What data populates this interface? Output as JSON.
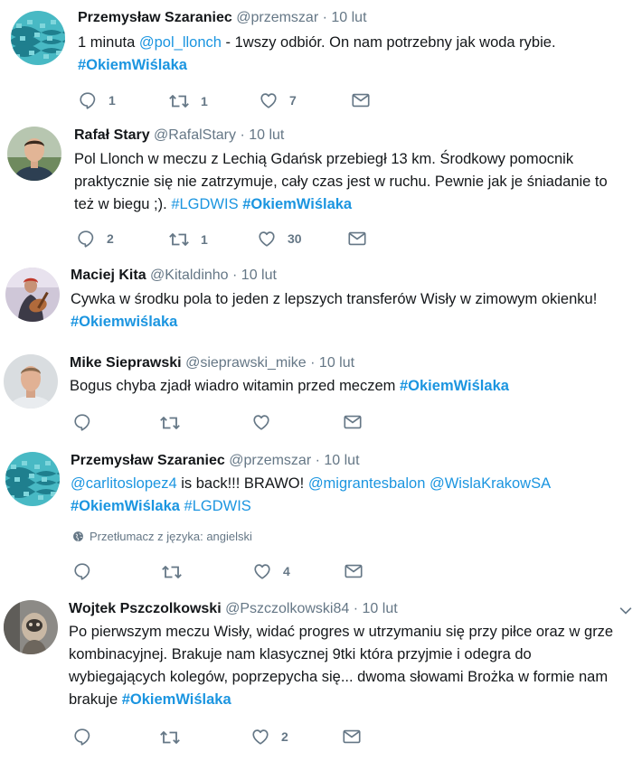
{
  "tweets": [
    {
      "name": "Przemysław Szaraniec",
      "handle": "@przemszar",
      "dot": "·",
      "date": "10 lut",
      "text_a": "1 minuta ",
      "mention": "@pol_llonch",
      "text_b": " - 1wszy odbiór. On nam potrzebny jak woda rybie.",
      "hashtag": "#OkiemWiślaka",
      "replies": "1",
      "retweets": "1",
      "likes": "7"
    },
    {
      "name": "Rafał Stary",
      "handle": "@RafalStary",
      "dot": "·",
      "date": "10 lut",
      "line1": "Pol Llonch w meczu z Lechią Gdańsk przebiegł 13 km. Środkowy pomocnik",
      "line2": "praktycznie się nie zatrzymuje, cały czas jest w ruchu. Pewnie jak je śniadanie to",
      "line3": "też w biegu ;). ",
      "hashtag1": "#LGDWIS",
      "hashtag2": "#OkiemWiślaka",
      "replies": "2",
      "retweets": "1",
      "likes": "30"
    },
    {
      "name": "Maciej Kita",
      "handle": "@Kitaldinho",
      "dot": "·",
      "date": "10 lut",
      "text": "Cywka w środku pola to jeden z lepszych transferów Wisły w zimowym okienku!",
      "hashtag": "#Okiemwiślaka"
    },
    {
      "name": "Mike Sieprawski",
      "handle": "@sieprawski_mike",
      "dot": "·",
      "date": "10 lut",
      "text": "Bogus chyba zjadł wiadro witamin przed meczem ",
      "hashtag": "#OkiemWiślaka"
    },
    {
      "name": "Przemysław Szaraniec",
      "handle": "@przemszar",
      "dot": "·",
      "date": "10 lut",
      "mention1": "@carlitoslopez4",
      "text_a": " is back!!! BRAWO! ",
      "mention2": "@migrantesbalon",
      "mention3": "@WislaKrakowSA",
      "hashtag1": "#OkiemWiślaka",
      "hashtag2": "#LGDWIS",
      "translate": "Przetłumacz z języka: angielski",
      "likes": "4"
    },
    {
      "name": "Wojtek Pszczolkowski",
      "handle": "@Pszczolkowski84",
      "dot": "·",
      "date": "10 lut",
      "line1": "Po pierwszym meczu Wisły, widać progres w utrzymaniu się przy piłce oraz w grze",
      "line2": "kombinacyjnej. Brakuje nam klasycznej 9tki która przyjmie i odegra do",
      "line3": "wybiegających kolegów, poprzepycha się... dwoma słowami Brożka w formie nam",
      "line4": "brakuje ",
      "hashtag": "#OkiemWiślaka",
      "likes": "2"
    }
  ],
  "colors": {
    "link": "#1b95e0",
    "muted": "#657786",
    "text": "#14171a"
  },
  "icons": [
    "reply-icon",
    "retweet-icon",
    "like-icon",
    "message-icon",
    "globe-icon",
    "chevron-down-icon"
  ]
}
